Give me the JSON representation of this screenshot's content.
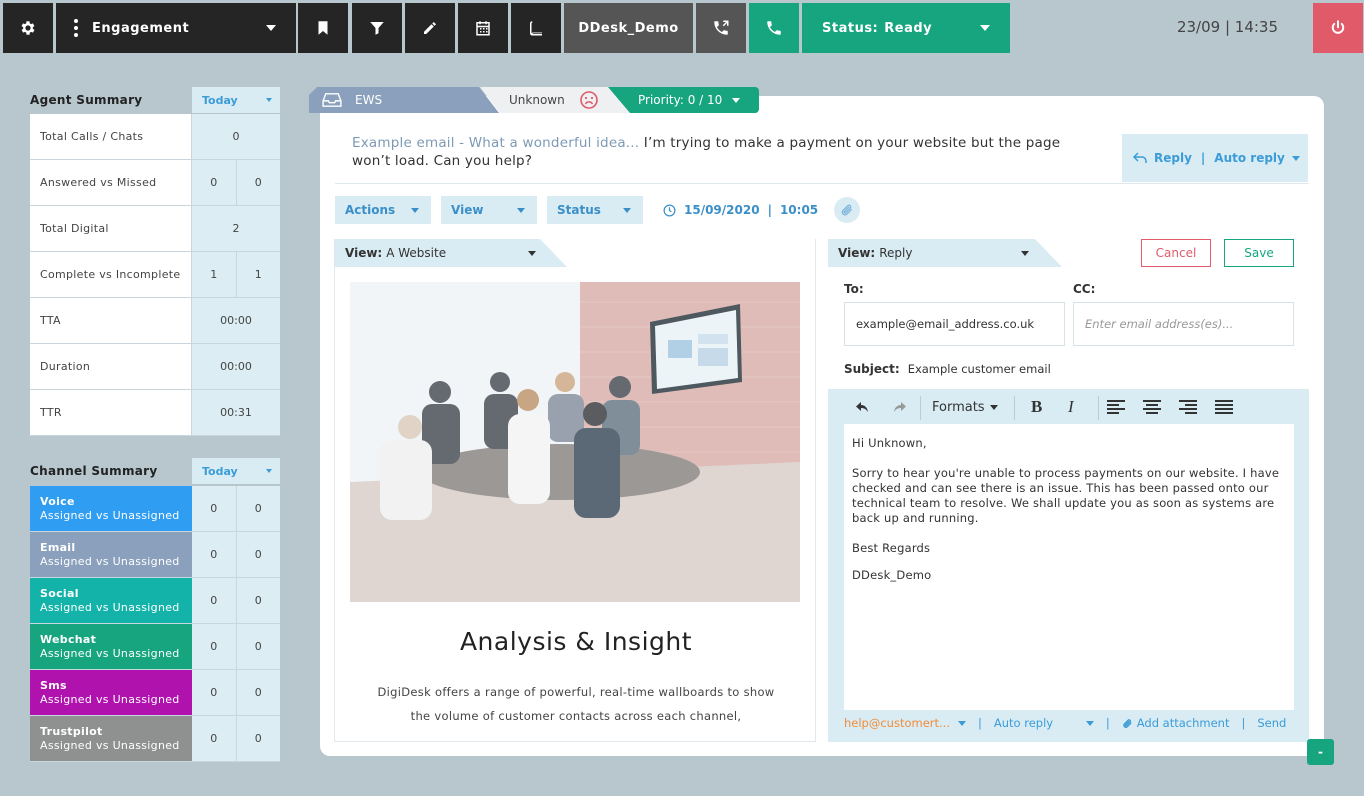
{
  "topbar": {
    "engagement_label": "Engagement",
    "profile_label": "DDesk_Demo",
    "status_label": "Status:",
    "status_value": "Ready",
    "datetime": "23/09 | 14:35"
  },
  "agent_summary": {
    "title": "Agent Summary",
    "period": "Today",
    "rows": [
      {
        "label": "Total Calls / Chats",
        "values": [
          "0"
        ]
      },
      {
        "label": "Answered vs Missed",
        "values": [
          "0",
          "0"
        ]
      },
      {
        "label": "Total Digital",
        "values": [
          "2"
        ]
      },
      {
        "label": "Complete vs Incomplete",
        "values": [
          "1",
          "1"
        ]
      },
      {
        "label": "TTA",
        "values": [
          "00:00"
        ]
      },
      {
        "label": "Duration",
        "values": [
          "00:00"
        ]
      },
      {
        "label": "TTR",
        "values": [
          "00:31"
        ]
      }
    ]
  },
  "channel_summary": {
    "title": "Channel Summary",
    "period": "Today",
    "rows": [
      {
        "name": "Voice",
        "sub": "Assigned vs Unassigned",
        "values": [
          "0",
          "0"
        ],
        "color": "#2e9df2"
      },
      {
        "name": "Email",
        "sub": "Assigned vs Unassigned",
        "values": [
          "0",
          "0"
        ],
        "color": "#8aa0bc"
      },
      {
        "name": "Social",
        "sub": "Assigned vs Unassigned",
        "values": [
          "0",
          "0"
        ],
        "color": "#14b3aa"
      },
      {
        "name": "Webchat",
        "sub": "Assigned vs Unassigned",
        "values": [
          "0",
          "0"
        ],
        "color": "#17a57f"
      },
      {
        "name": "Sms",
        "sub": "Assigned vs Unassigned",
        "values": [
          "0",
          "0"
        ],
        "color": "#b012ad"
      },
      {
        "name": "Trustpilot",
        "sub": "Assigned vs Unassigned",
        "values": [
          "0",
          "0"
        ],
        "color": "#8f9191"
      }
    ]
  },
  "tabs": {
    "ews": "EWS",
    "sentiment": "Unknown",
    "priority": "Priority: 0 / 10"
  },
  "email": {
    "subject_highlight": "Example email - What a wonderful idea...",
    "subject_body": " I’m trying to make a payment on your website but the page won’t load. Can you help?",
    "reply_label": "Reply",
    "reply_sep": "|",
    "auto_reply_label": "Auto reply",
    "actions_label": "Actions",
    "view_label": "View",
    "status_label": "Status",
    "date": "15/09/2020",
    "date_sep": "|",
    "time": "10:05"
  },
  "left_view": {
    "view_prefix": "View:",
    "view_value": "A Website",
    "heading": "Analysis & Insight",
    "paragraph": "DigiDesk offers a range of powerful, real-time wallboards to show the volume of customer contacts across each channel,"
  },
  "reply_view": {
    "view_prefix": "View:",
    "view_value": "Reply",
    "cancel_label": "Cancel",
    "save_label": "Save",
    "to_label": "To:",
    "to_value": "example@email_address.co.uk",
    "cc_label": "CC:",
    "cc_placeholder": "Enter email address(es)...",
    "subject_label": "Subject:",
    "subject_value": "Example customer email",
    "formats_label": "Formats",
    "body_greeting": "Hi Unknown,",
    "body_para": "Sorry to hear you're unable to process payments on our website. I have checked and can see there is an issue. This has been passed onto our technical team to resolve. We shall update you as soon as systems are back up and running.",
    "body_signoff": "Best Regards",
    "body_signature": "DDesk_Demo",
    "from_address": "help@customert...",
    "auto_reply_select": "Auto reply",
    "add_attachment": "Add attachment",
    "send_label": "Send",
    "sep": "|"
  },
  "collapse_label": "-",
  "colors": {
    "accent_green": "#17a57f",
    "accent_blue": "#3b9cd8",
    "power_red": "#e05a6a",
    "dark": "#252525"
  }
}
